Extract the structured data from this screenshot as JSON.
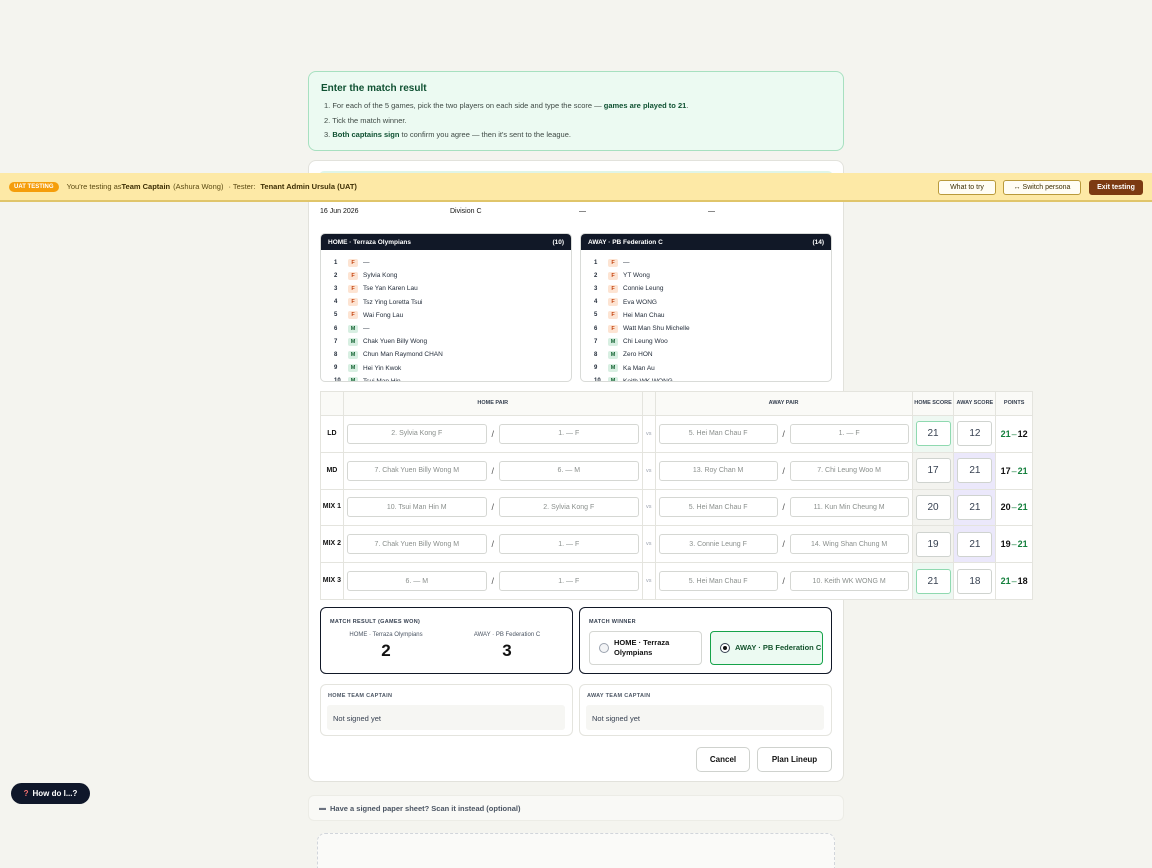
{
  "instructions": {
    "title": "Enter the match result",
    "step1_pre": "1. For each of the 5 games, pick the two players on each side and type the score — ",
    "step1_bold": "games are played to 21",
    "step1_post": ".",
    "step2": "2. Tick the match winner.",
    "step3_pre": "3. ",
    "step3_bold": "Both captains sign",
    "step3_post": " to confirm you agree — then it's sent to the league."
  },
  "uat_banner": {
    "badge": "UAT TESTING",
    "testing_as_pre": "You're testing as ",
    "persona": "Team Captain",
    "persona_name": "(Ashura Wong)",
    "tester_pre": "· Tester: ",
    "tester": "Tenant Admin Ursula (UAT)",
    "what_to_try": "What to try",
    "switch_persona": "↔ Switch persona",
    "exit_testing": "Exit testing"
  },
  "meta": {
    "match_date": "16 Jun 2026",
    "division": "Division C",
    "col3_value": "—",
    "col4_value": "—"
  },
  "home_roster": {
    "title": "HOME · Terraza Olympians",
    "count": "(10)",
    "players": [
      {
        "num": "1",
        "sex": "F",
        "name": "—"
      },
      {
        "num": "2",
        "sex": "F",
        "name": "Sylvia Kong"
      },
      {
        "num": "3",
        "sex": "F",
        "name": "Tse Yan Karen Lau"
      },
      {
        "num": "4",
        "sex": "F",
        "name": "Tsz Ying Loretta Tsui"
      },
      {
        "num": "5",
        "sex": "F",
        "name": "Wai Fong Lau"
      },
      {
        "num": "6",
        "sex": "M",
        "name": "—"
      },
      {
        "num": "7",
        "sex": "M",
        "name": "Chak Yuen Billy Wong"
      },
      {
        "num": "8",
        "sex": "M",
        "name": "Chun Man Raymond CHAN"
      },
      {
        "num": "9",
        "sex": "M",
        "name": "Hei Yin Kwok"
      },
      {
        "num": "10",
        "sex": "M",
        "name": "Tsui Man Hin"
      }
    ]
  },
  "away_roster": {
    "title": "AWAY · PB Federation C",
    "count": "(14)",
    "players": [
      {
        "num": "1",
        "sex": "F",
        "name": "—"
      },
      {
        "num": "2",
        "sex": "F",
        "name": "YT Wong"
      },
      {
        "num": "3",
        "sex": "F",
        "name": "Connie Leung"
      },
      {
        "num": "4",
        "sex": "F",
        "name": "Eva WONG"
      },
      {
        "num": "5",
        "sex": "F",
        "name": "Hei Man Chau"
      },
      {
        "num": "6",
        "sex": "F",
        "name": "Watt Man Shu Michelle"
      },
      {
        "num": "7",
        "sex": "M",
        "name": "Chi Leung Woo"
      },
      {
        "num": "8",
        "sex": "M",
        "name": "Zero HON"
      },
      {
        "num": "9",
        "sex": "M",
        "name": "Ka Man Au"
      },
      {
        "num": "10",
        "sex": "M",
        "name": "Keith WK WONG"
      }
    ]
  },
  "games": {
    "headers": {
      "home_pair": "HOME PAIR",
      "away_pair": "AWAY PAIR",
      "home_score": "HOME SCORE",
      "away_score": "AWAY SCORE",
      "points": "POINTS"
    },
    "vs": "vs",
    "rows": [
      {
        "label": "LD",
        "h1": "2. Sylvia Kong F",
        "h2": "1. — F",
        "a1": "5. Hei Man Chau F",
        "a2": "1. — F",
        "hs": "21",
        "as": "12",
        "winner": "home"
      },
      {
        "label": "MD",
        "h1": "7. Chak Yuen Billy Wong M",
        "h2": "6. — M",
        "a1": "13. Roy Chan M",
        "a2": "7. Chi Leung Woo M",
        "hs": "17",
        "as": "21",
        "winner": "away"
      },
      {
        "label": "MIX 1",
        "h1": "10. Tsui Man Hin M",
        "h2": "2. Sylvia Kong F",
        "a1": "5. Hei Man Chau F",
        "a2": "11. Kun Min Cheung M",
        "hs": "20",
        "as": "21",
        "winner": "away"
      },
      {
        "label": "MIX 2",
        "h1": "7. Chak Yuen Billy Wong M",
        "h2": "1. — F",
        "a1": "3. Connie Leung F",
        "a2": "14. Wing Shan Chung M",
        "hs": "19",
        "as": "21",
        "winner": "away"
      },
      {
        "label": "MIX 3",
        "h1": "6. — M",
        "h2": "1. — F",
        "a1": "5. Hei Man Chau F",
        "a2": "10. Keith WK WONG M",
        "hs": "21",
        "as": "18",
        "winner": "home"
      }
    ]
  },
  "result": {
    "title": "MATCH RESULT (GAMES WON)",
    "home_label": "HOME · Terraza Olympians",
    "home_games": "2",
    "away_label": "AWAY · PB Federation C",
    "away_games": "3"
  },
  "winner": {
    "title": "MATCH WINNER",
    "home_option": "HOME · Terraza Olympians",
    "away_option": "AWAY · PB Federation C",
    "selected": "away"
  },
  "captains": {
    "home_title": "HOME TEAM CAPTAIN",
    "home_status": "Not signed yet",
    "away_title": "AWAY TEAM CAPTAIN",
    "away_status": "Not signed yet"
  },
  "actions": {
    "cancel": "Cancel",
    "plan_lineup": "Plan Lineup"
  },
  "scan": {
    "text": "Have a signed paper sheet? Scan it instead (optional)"
  },
  "help": {
    "label": "How do I...?"
  },
  "colors": {
    "accent_green": "#15803d",
    "banner_yellow": "#fde9a6",
    "dark": "#111827"
  }
}
